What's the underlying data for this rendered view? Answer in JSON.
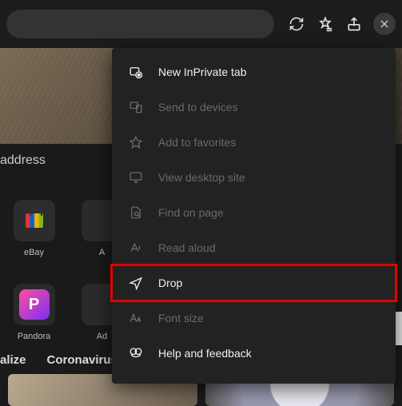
{
  "topbar": {
    "refresh": "Refresh",
    "favorites": "Favorites",
    "share": "Share",
    "close": "Close"
  },
  "address_hint": "address",
  "tiles": {
    "row1": [
      {
        "label": "eBay"
      },
      {
        "label": "A"
      }
    ],
    "row2": [
      {
        "label": "Pandora"
      },
      {
        "label": "Ad"
      }
    ]
  },
  "news": {
    "tab1": "alize",
    "tab2": "Coronavirus"
  },
  "menu": {
    "items": [
      {
        "key": "new-inprivate",
        "label": "New InPrivate tab",
        "enabled": true
      },
      {
        "key": "send-devices",
        "label": "Send to devices",
        "enabled": false
      },
      {
        "key": "add-favorites",
        "label": "Add to favorites",
        "enabled": false
      },
      {
        "key": "view-desktop",
        "label": "View desktop site",
        "enabled": false
      },
      {
        "key": "find-on-page",
        "label": "Find on page",
        "enabled": false
      },
      {
        "key": "read-aloud",
        "label": "Read aloud",
        "enabled": false
      },
      {
        "key": "drop",
        "label": "Drop",
        "enabled": true,
        "highlight": true
      },
      {
        "key": "font-size",
        "label": "Font size",
        "enabled": false
      },
      {
        "key": "help-feedback",
        "label": "Help and feedback",
        "enabled": true
      }
    ]
  }
}
